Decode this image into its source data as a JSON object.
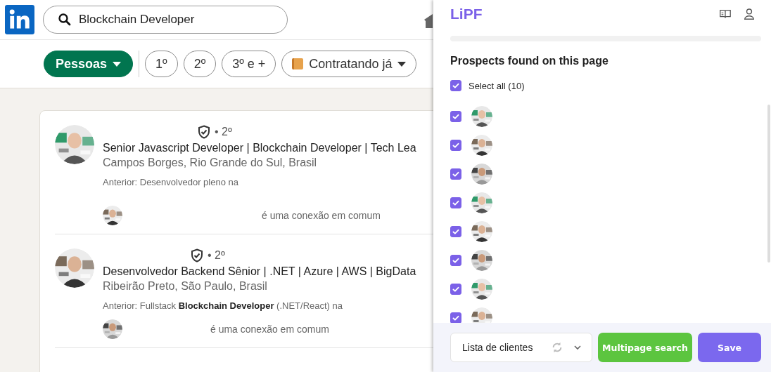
{
  "search": {
    "value": "Blockchain Developer"
  },
  "filters": [
    {
      "label": "Pessoas",
      "kind": "dropdown",
      "selected": true
    },
    {
      "label": "1º",
      "kind": "pill",
      "selected": false
    },
    {
      "label": "2º",
      "kind": "pill",
      "selected": false
    },
    {
      "label": "3º e +",
      "kind": "pill",
      "selected": false
    },
    {
      "label": "Contratando já",
      "kind": "badge-dropdown",
      "selected": false
    }
  ],
  "results": [
    {
      "degree": "• 2º",
      "headline": "Senior Javascript Developer | Blockchain Developer | Tech Lea",
      "location": "Campos Borges, Rio Grande do Sul, Brasil",
      "snippet": "Anterior: Desenvolvedor pleno na",
      "mutual": "é uma conexão em comum"
    },
    {
      "degree": "• 2º",
      "headline": "Desenvolvedor Backend Sênior | .NET | Azure | AWS | BigData",
      "location": "Ribeirão Preto, São Paulo, Brasil",
      "snippet": "Anterior: Fullstack **Blockchain Developer** (.NET/React) na",
      "mutual": "é uma conexão em comum"
    }
  ],
  "panel": {
    "logo": "LiPF",
    "heading": "Prospects found on this page",
    "select_all": {
      "label": "Select all (10)",
      "checked": true
    },
    "prospects": [
      {
        "checked": true
      },
      {
        "checked": true
      },
      {
        "checked": true
      },
      {
        "checked": true
      },
      {
        "checked": true
      },
      {
        "checked": true
      },
      {
        "checked": true
      },
      {
        "checked": true
      }
    ],
    "list_select": {
      "value": "Lista de clientes"
    },
    "buttons": [
      {
        "label": "Multipage search",
        "kind": "secondary"
      },
      {
        "label": "Save",
        "kind": "primary"
      }
    ]
  }
}
